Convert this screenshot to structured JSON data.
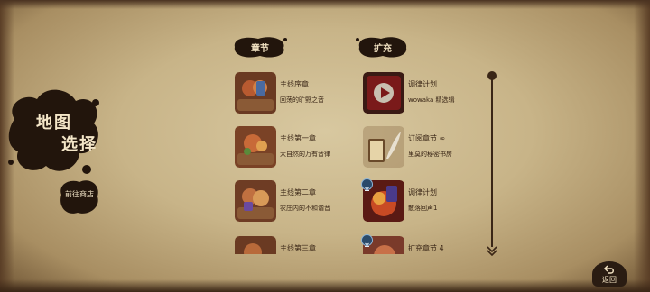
{
  "screen": {
    "title_line1": "地图",
    "title_line2": "选择",
    "shop_button": "前往商店",
    "back_button": "返回"
  },
  "columns": {
    "chapters_header": "章节",
    "expansion_header": "扩充"
  },
  "chapters": [
    {
      "title": "主线序章",
      "subtitle": "回荡的旷野之音"
    },
    {
      "title": "主线第一章",
      "subtitle": "大自然的万有音律"
    },
    {
      "title": "主线第二章",
      "subtitle": "农庄内的不和谐音"
    },
    {
      "title": "主线第三章",
      "subtitle": ""
    }
  ],
  "expansions": [
    {
      "title": "调律计划",
      "subtitle": "wowaka 精选辑",
      "icon": "play-icon"
    },
    {
      "title": "订阅章节 ∞",
      "subtitle": "里莫的秘密书房",
      "icon": "quill-icon"
    },
    {
      "title": "调律计划",
      "subtitle": "散落回声1",
      "icon": "download-icon"
    },
    {
      "title": "扩充章节 4",
      "subtitle": "",
      "icon": "download-icon"
    }
  ],
  "colors": {
    "ink": "#2a1a10",
    "paper": "#cdb98e",
    "text_light": "#f2e2c2",
    "accent_red": "#8a1e1e"
  }
}
